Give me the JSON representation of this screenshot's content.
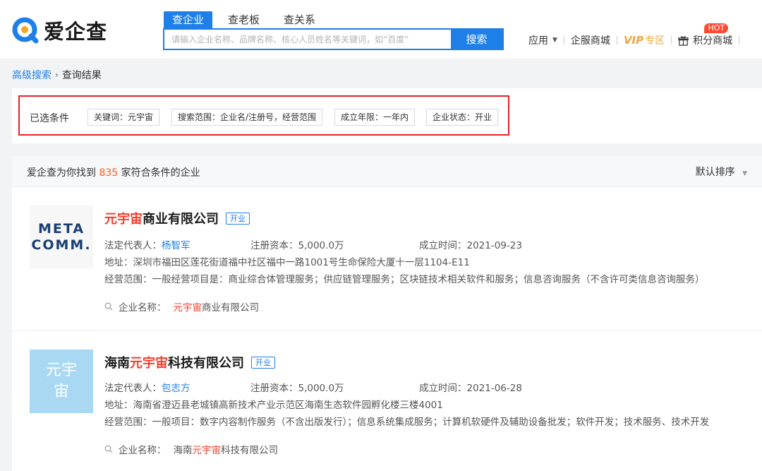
{
  "header": {
    "logo_text": "爱企查",
    "tabs": [
      "查企业",
      "查老板",
      "查关系"
    ],
    "search_placeholder": "请输入企业名称、品牌名称、核心人员姓名等关键词，如“百度”",
    "search_button": "搜索",
    "nav": {
      "apps": "应用",
      "mall": "企服商城",
      "vip": "VIP",
      "vip_zone": "专区",
      "points": "积分商城",
      "hot": "HOT"
    }
  },
  "breadcrumb": {
    "link": "高级搜索",
    "current": "查询结果"
  },
  "conditions": {
    "label": "已选条件",
    "chips": [
      "关键词：元宇宙",
      "搜索范围：企业名/注册号，经营范围",
      "成立年限：一年内",
      "企业状态：开业"
    ]
  },
  "results": {
    "found_prefix": "爱企查为你找到",
    "count": "835",
    "found_suffix": "家符合条件的企业",
    "sort_label": "默认排序",
    "items": [
      {
        "logo_line1": "META",
        "logo_line2": "COMM.",
        "name_pre": "",
        "name_hl": "元宇宙",
        "name_post": "商业有限公司",
        "status": "开业",
        "rep_label": "法定代表人：",
        "rep": "杨智军",
        "capital": "注册资本：5,000.0万",
        "founded": "成立时间：2021-09-23",
        "address": "地址：深圳市福田区莲花街道福中社区福中一路1001号生命保险大厦十一层1104-E11",
        "scope": "经营范围：一般经营项目是：商业综合体管理服务；供应链管理服务；区块链技术相关软件和服务；信息咨询服务（不含许可类信息咨询服务）",
        "match_label": "企业名称：",
        "match_pre": "",
        "match_hl": "元宇宙",
        "match_post": "商业有限公司"
      },
      {
        "logo_line1": "元宇",
        "logo_line2": "宙",
        "name_pre": "海南",
        "name_hl": "元宇宙",
        "name_post": "科技有限公司",
        "status": "开业",
        "rep_label": "法定代表人：",
        "rep": "包志方",
        "capital": "注册资本：5,000.0万",
        "founded": "成立时间：2021-06-28",
        "address": "地址：海南省澄迈县老城镇高新技术产业示范区海南生态软件园孵化楼三楼4001",
        "scope": "经营范围：一般项目：数字内容制作服务（不含出版发行）；信息系统集成服务；计算机软硬件及辅助设备批发；软件开发；技术服务、技术开发",
        "match_label": "企业名称：",
        "match_pre": "海南",
        "match_hl": "元宇宙",
        "match_post": "科技有限公司"
      }
    ]
  },
  "colors": {
    "accent": "#1e7fe8",
    "highlight": "#f53c2b",
    "count": "#ff5a21",
    "frame": "#e8212a",
    "vip": "#f0a53b"
  }
}
